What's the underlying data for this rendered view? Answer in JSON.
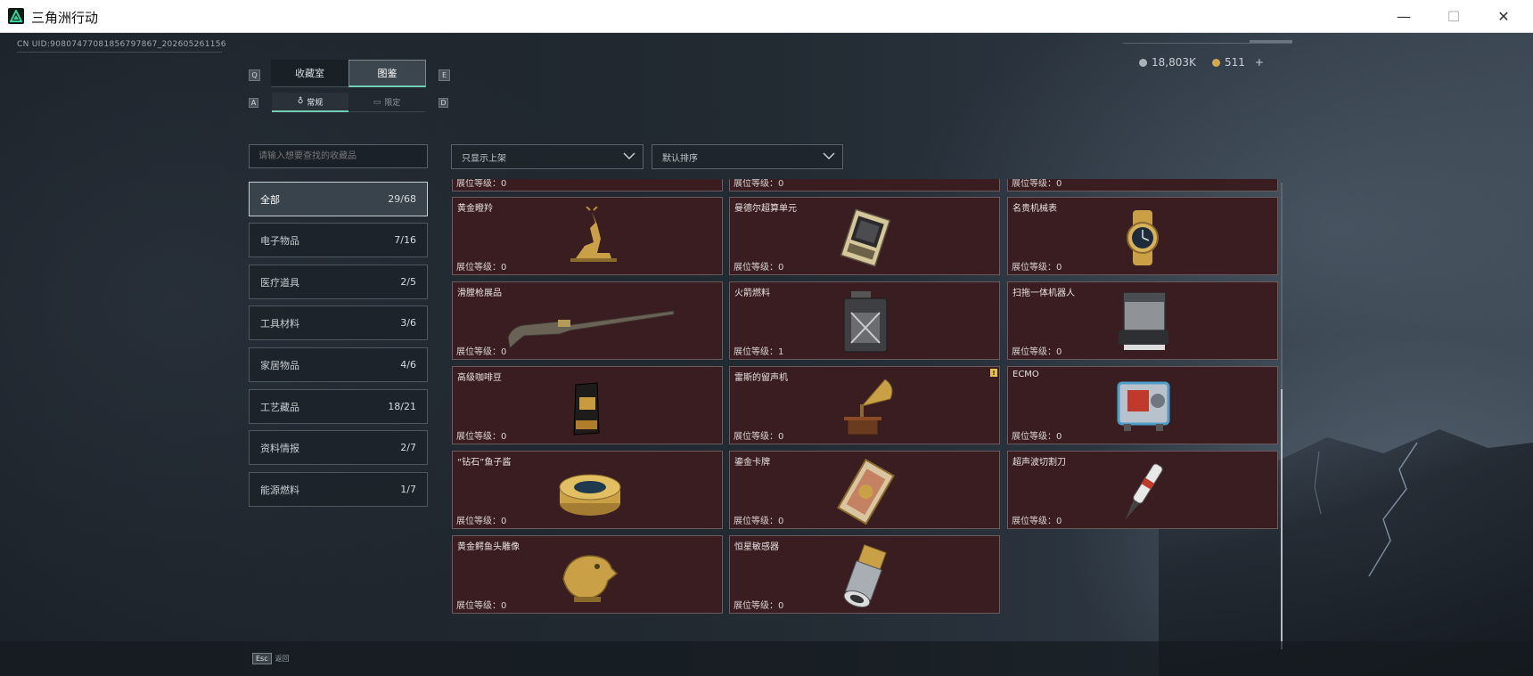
{
  "window": {
    "title": "三角洲行动",
    "minimize": "—",
    "maximize": "☐",
    "close": "✕"
  },
  "header": {
    "uid": "CN UID:90807477081856797867_202605261156",
    "currency_1": "18,803K",
    "currency_2": "511",
    "currency_add": "+"
  },
  "tabs": {
    "left_key": "Q",
    "right_key": "E",
    "items": [
      {
        "label": "收藏室",
        "active": false
      },
      {
        "label": "图鉴",
        "active": true
      }
    ],
    "sub_left_key": "A",
    "sub_right_key": "D",
    "subitems": [
      {
        "label": "常规",
        "active": true
      },
      {
        "label": "限定",
        "active": false
      }
    ]
  },
  "search": {
    "placeholder": "请输入想要查找的收藏品"
  },
  "categories": [
    {
      "label": "全部",
      "count": "29/68",
      "active": true
    },
    {
      "label": "电子物品",
      "count": "7/16"
    },
    {
      "label": "医疗道具",
      "count": "2/5"
    },
    {
      "label": "工具材料",
      "count": "3/6"
    },
    {
      "label": "家居物品",
      "count": "4/6"
    },
    {
      "label": "工艺藏品",
      "count": "18/21"
    },
    {
      "label": "资料情报",
      "count": "2/7"
    },
    {
      "label": "能源燃料",
      "count": "1/7"
    }
  ],
  "filters": {
    "display": "只显示上架",
    "sort": "默认排序"
  },
  "level_prefix": "展位等级：",
  "items": [
    {
      "name": "",
      "level": "0",
      "icon": "item-partial"
    },
    {
      "name": "",
      "level": "0",
      "icon": "item-partial"
    },
    {
      "name": "",
      "level": "0",
      "icon": "item-partial"
    },
    {
      "name": "黄金瞪羚",
      "level": "0",
      "icon": "golden-gazelle-icon"
    },
    {
      "name": "曼德尔超算单元",
      "level": "0",
      "icon": "supercomputer-unit-icon"
    },
    {
      "name": "名贵机械表",
      "level": "0",
      "icon": "luxury-watch-icon"
    },
    {
      "name": "滑膛枪展品",
      "level": "0",
      "icon": "musket-icon"
    },
    {
      "name": "火箭燃料",
      "level": "1",
      "icon": "rocket-fuel-icon"
    },
    {
      "name": "扫拖一体机器人",
      "level": "0",
      "icon": "cleaning-robot-icon"
    },
    {
      "name": "高级咖啡豆",
      "level": "0",
      "icon": "coffee-beans-icon"
    },
    {
      "name": "雷斯的留声机",
      "level": "0",
      "icon": "gramophone-icon",
      "warning": "!"
    },
    {
      "name": "ECMO",
      "level": "0",
      "icon": "ecmo-icon"
    },
    {
      "name": "“钻石”鱼子酱",
      "level": "0",
      "icon": "caviar-icon"
    },
    {
      "name": "鎏金卡牌",
      "level": "0",
      "icon": "gilded-card-icon"
    },
    {
      "name": "超声波切割刀",
      "level": "0",
      "icon": "ultrasonic-cutter-icon"
    },
    {
      "name": "黄金鳄鱼头雕像",
      "level": "0",
      "icon": "crocodile-statue-icon"
    },
    {
      "name": "恒星敏感器",
      "level": "0",
      "icon": "star-sensor-icon"
    }
  ],
  "footer": {
    "esc_key": "Esc",
    "esc_label": "返回"
  }
}
